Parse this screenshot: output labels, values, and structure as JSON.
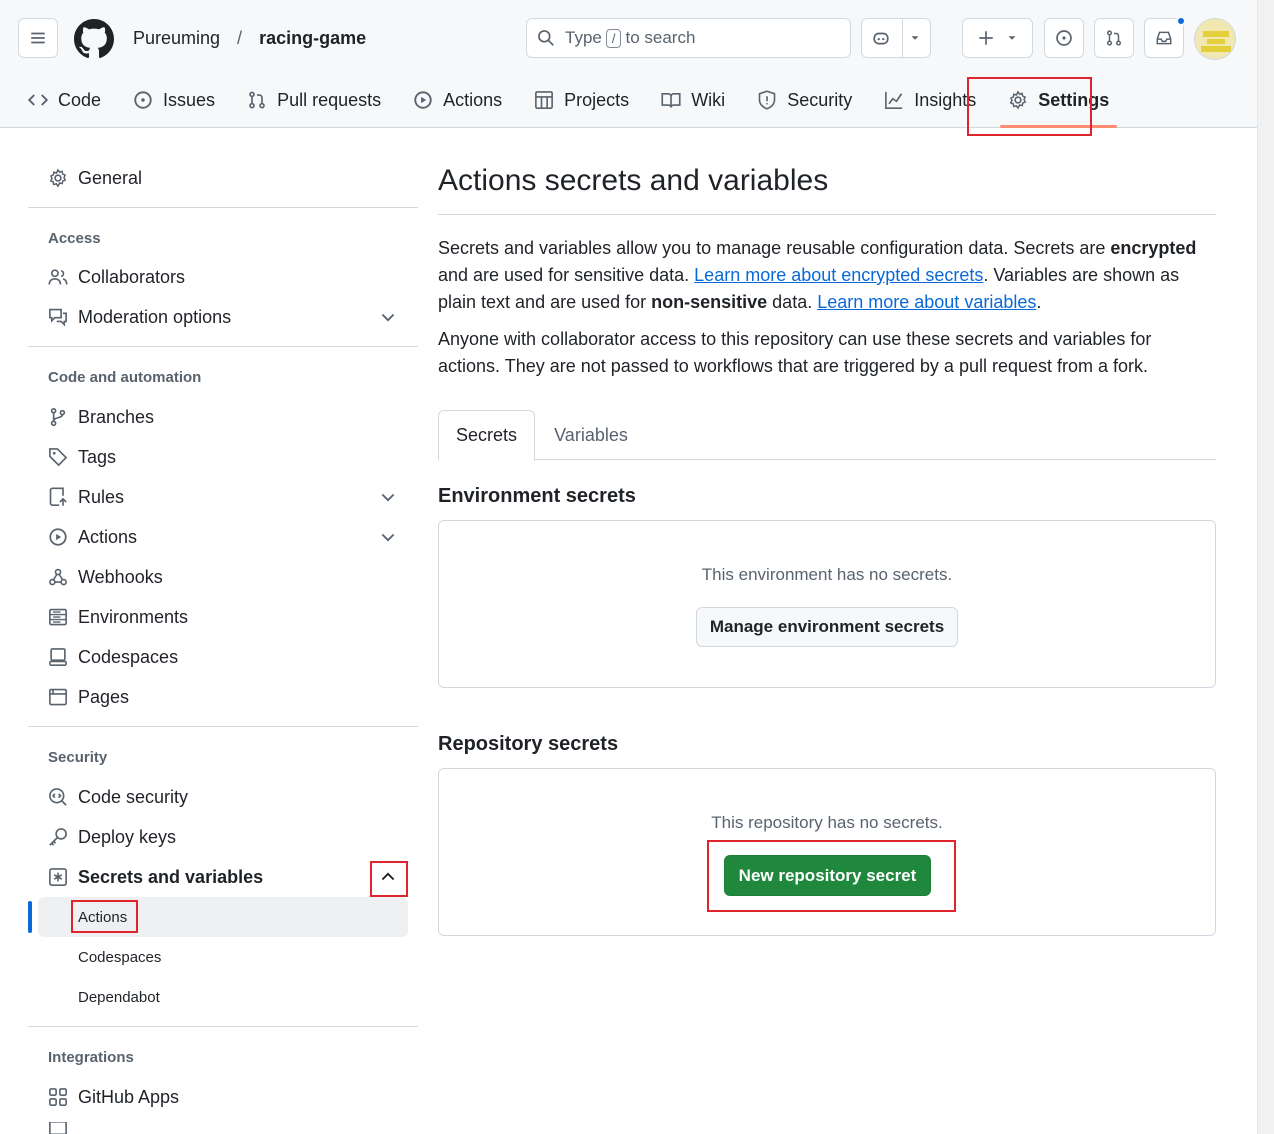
{
  "header": {
    "owner": "Pureuming",
    "separator": "/",
    "repo": "racing-game",
    "search": {
      "prefix": "Type",
      "key": "/",
      "suffix": "to search"
    }
  },
  "tabs": [
    {
      "label": "Code",
      "icon": "code-icon"
    },
    {
      "label": "Issues",
      "icon": "issue-icon"
    },
    {
      "label": "Pull requests",
      "icon": "pull-request-icon"
    },
    {
      "label": "Actions",
      "icon": "play-icon"
    },
    {
      "label": "Projects",
      "icon": "table-icon"
    },
    {
      "label": "Wiki",
      "icon": "book-icon"
    },
    {
      "label": "Security",
      "icon": "shield-icon"
    },
    {
      "label": "Insights",
      "icon": "graph-icon"
    },
    {
      "label": "Settings",
      "icon": "gear-icon",
      "active": true
    }
  ],
  "sidebar": {
    "general": "General",
    "access_heading": "Access",
    "collaborators": "Collaborators",
    "moderation": "Moderation options",
    "code_heading": "Code and automation",
    "branches": "Branches",
    "tags": "Tags",
    "rules": "Rules",
    "actions": "Actions",
    "webhooks": "Webhooks",
    "environments": "Environments",
    "codespaces": "Codespaces",
    "pages": "Pages",
    "security_heading": "Security",
    "code_security": "Code security",
    "deploy_keys": "Deploy keys",
    "secrets": "Secrets and variables",
    "sub_actions": "Actions",
    "sub_codespaces": "Codespaces",
    "sub_dependabot": "Dependabot",
    "integrations_heading": "Integrations",
    "github_apps": "GitHub Apps"
  },
  "main": {
    "title": "Actions secrets and variables",
    "p1a": "Secrets and variables allow you to manage reusable configuration data. Secrets are ",
    "p1b": "encrypted",
    "p1c": " and are used for sensitive data. ",
    "p1link1": "Learn more about encrypted secrets",
    "p1d": ". Variables are shown as plain text and are used for ",
    "p1e": "non-sensitive",
    "p1f": " data. ",
    "p1link2": "Learn more about variables",
    "p1g": ".",
    "p2": "Anyone with collaborator access to this repository can use these secrets and variables for actions. They are not passed to workflows that are triggered by a pull request from a fork.",
    "tab_secrets": "Secrets",
    "tab_variables": "Variables",
    "env_heading": "Environment secrets",
    "env_empty": "This environment has no secrets.",
    "env_button": "Manage environment secrets",
    "repo_heading": "Repository secrets",
    "repo_empty": "This repository has no secrets.",
    "repo_button": "New repository secret"
  },
  "colors": {
    "accent": "#0969da",
    "primary_button": "#1f883d",
    "highlight_box": "#e0242e",
    "tab_underline": "#fd8c73"
  }
}
